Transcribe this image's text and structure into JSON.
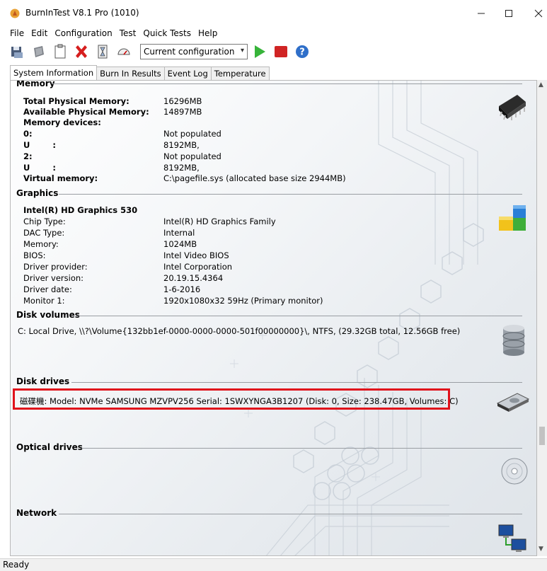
{
  "window": {
    "title": "BurnInTest V8.1 Pro (1010)"
  },
  "menu": {
    "items": [
      "File",
      "Edit",
      "Configuration",
      "Test",
      "Quick Tests",
      "Help"
    ]
  },
  "toolbar": {
    "config_value": "Current configuration"
  },
  "tabs": [
    "System Information",
    "Burn In Results",
    "Event Log",
    "Temperature"
  ],
  "memory": {
    "title": "Memory",
    "rows": [
      {
        "k": "Total Physical Memory:",
        "v": "16296MB",
        "bold": true
      },
      {
        "k": "Available Physical Memory:",
        "v": "14897MB",
        "bold": true
      },
      {
        "k": "Memory devices:",
        "v": "",
        "bold": true
      },
      {
        "k": "0:",
        "v": "Not populated",
        "bold": true
      },
      {
        "k": "U        :",
        "v": "8192MB,",
        "bold": true
      },
      {
        "k": "2:",
        "v": "Not populated",
        "bold": true
      },
      {
        "k": "U        :",
        "v": "8192MB,",
        "bold": true
      },
      {
        "k": "Virtual memory:",
        "v": "C:\\pagefile.sys (allocated base size 2944MB)",
        "bold": true
      }
    ]
  },
  "graphics": {
    "title": "Graphics",
    "adapter": "Intel(R) HD Graphics 530",
    "rows": [
      {
        "k": "Chip Type:",
        "v": "Intel(R) HD Graphics Family"
      },
      {
        "k": "DAC Type:",
        "v": "Internal"
      },
      {
        "k": "Memory:",
        "v": "1024MB"
      },
      {
        "k": "BIOS:",
        "v": "Intel Video BIOS"
      },
      {
        "k": "Driver provider:",
        "v": "Intel Corporation"
      },
      {
        "k": "Driver version:",
        "v": "20.19.15.4364"
      },
      {
        "k": "Driver date:",
        "v": "1-6-2016"
      },
      {
        "k": "Monitor 1:",
        "v": "1920x1080x32 59Hz (Primary monitor)"
      }
    ]
  },
  "disk_volumes": {
    "title": "Disk volumes",
    "line": "C:  Local Drive, \\\\?\\Volume{132bb1ef-0000-0000-0000-501f00000000}\\, NTFS, (29.32GB total, 12.56GB free)"
  },
  "disk_drives": {
    "title": "Disk drives",
    "line": "磁碟機: Model: NVMe SAMSUNG MZVPV256 Serial: 1SWXYNGA3B1207 (Disk: 0, Size: 238.47GB, Volumes: C)"
  },
  "optical": {
    "title": "Optical drives"
  },
  "network": {
    "title": "Network"
  },
  "status": {
    "text": "Ready"
  },
  "colors": {
    "highlight": "#e0111b",
    "panel_bg": "#eef1f4"
  }
}
